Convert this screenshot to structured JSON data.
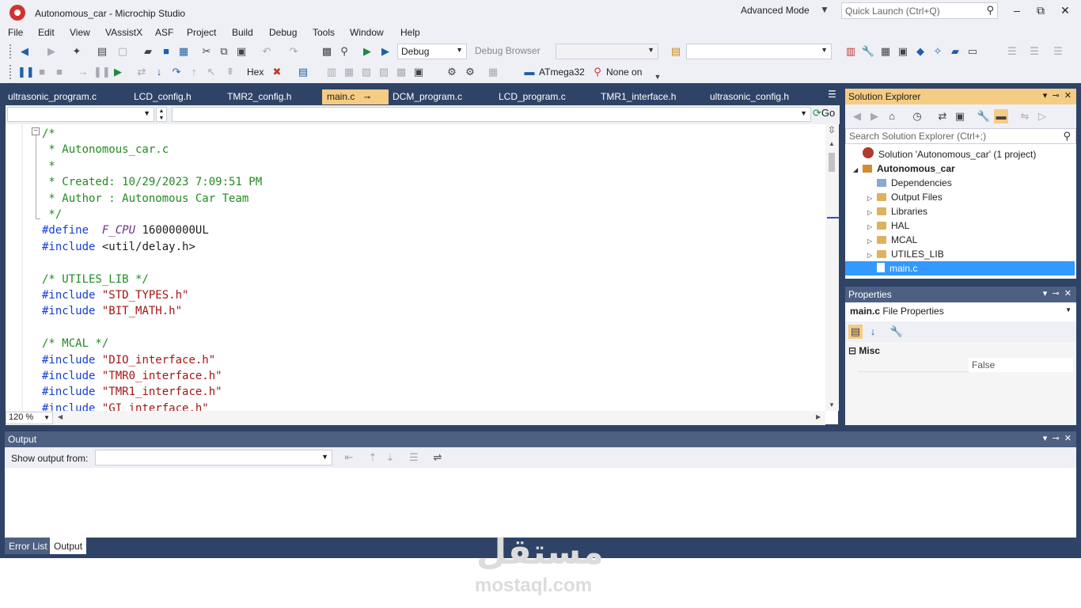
{
  "window": {
    "title": "Autonomous_car - Microchip Studio",
    "mode_label": "Advanced Mode",
    "quick_launch_placeholder": "Quick Launch (Ctrl+Q)",
    "minimize": "–",
    "maximize": "⧉",
    "close": "✕"
  },
  "menu": [
    "File",
    "Edit",
    "View",
    "VAssistX",
    "ASF",
    "Project",
    "Build",
    "Debug",
    "Tools",
    "Window",
    "Help"
  ],
  "toolbar": {
    "config_combo": "Debug",
    "debug_browser": "Debug Browser",
    "hex_label": "Hex",
    "device_label": "ATmega32",
    "tool_label": "None on"
  },
  "tabs": [
    {
      "label": "ultrasonic_program.c",
      "active": false
    },
    {
      "label": "LCD_config.h",
      "active": false
    },
    {
      "label": "TMR2_config.h",
      "active": false
    },
    {
      "label": "main.c",
      "active": true
    },
    {
      "label": "DCM_program.c",
      "active": false
    },
    {
      "label": "LCD_program.c",
      "active": false
    },
    {
      "label": "TMR1_interface.h",
      "active": false
    },
    {
      "label": "ultrasonic_config.h",
      "active": false
    }
  ],
  "editor": {
    "go_label": "Go",
    "zoom": "120 %",
    "lines": [
      [
        {
          "t": "cm",
          "v": "/*"
        }
      ],
      [
        {
          "t": "cm",
          "v": " * Autonomous_car.c"
        }
      ],
      [
        {
          "t": "cm",
          "v": " *"
        }
      ],
      [
        {
          "t": "cm",
          "v": " * Created: 10/29/2023 7:09:51 PM"
        }
      ],
      [
        {
          "t": "cm",
          "v": " * Author : Autonomous Car Team"
        }
      ],
      [
        {
          "t": "cm",
          "v": " */"
        }
      ],
      [
        {
          "t": "kw",
          "v": "#define"
        },
        {
          "t": "plain",
          "v": "  "
        },
        {
          "t": "mac",
          "v": "F_CPU"
        },
        {
          "t": "plain",
          "v": " 16000000UL"
        }
      ],
      [
        {
          "t": "kw",
          "v": "#include"
        },
        {
          "t": "plain",
          "v": " <util/delay.h>"
        }
      ],
      [
        {
          "t": "plain",
          "v": ""
        }
      ],
      [
        {
          "t": "cm",
          "v": "/* UTILES_LIB */"
        }
      ],
      [
        {
          "t": "kw",
          "v": "#include"
        },
        {
          "t": "plain",
          "v": " "
        },
        {
          "t": "str",
          "v": "\"STD_TYPES.h\""
        }
      ],
      [
        {
          "t": "kw",
          "v": "#include"
        },
        {
          "t": "plain",
          "v": " "
        },
        {
          "t": "str",
          "v": "\"BIT_MATH.h\""
        }
      ],
      [
        {
          "t": "plain",
          "v": ""
        }
      ],
      [
        {
          "t": "cm",
          "v": "/* MCAL */"
        }
      ],
      [
        {
          "t": "kw",
          "v": "#include"
        },
        {
          "t": "plain",
          "v": " "
        },
        {
          "t": "str",
          "v": "\"DIO_interface.h\""
        }
      ],
      [
        {
          "t": "kw",
          "v": "#include"
        },
        {
          "t": "plain",
          "v": " "
        },
        {
          "t": "str",
          "v": "\"TMR0_interface.h\""
        }
      ],
      [
        {
          "t": "kw",
          "v": "#include"
        },
        {
          "t": "plain",
          "v": " "
        },
        {
          "t": "str",
          "v": "\"TMR1_interface.h\""
        }
      ],
      [
        {
          "t": "kw",
          "v": "#include"
        },
        {
          "t": "plain",
          "v": " "
        },
        {
          "t": "str",
          "v": "\"GI_interface.h\""
        }
      ]
    ]
  },
  "solution_explorer": {
    "title": "Solution Explorer",
    "search_placeholder": "Search Solution Explorer (Ctrl+;)",
    "items": [
      {
        "label": "Solution 'Autonomous_car' (1 project)",
        "icon": "solution-icon",
        "expander": "",
        "level": 0,
        "bold": false,
        "selected": false
      },
      {
        "label": "Autonomous_car",
        "icon": "project-icon",
        "expander": "◢",
        "level": 0,
        "bold": true,
        "selected": false
      },
      {
        "label": "Dependencies",
        "icon": "dependencies-icon",
        "expander": "",
        "level": 1,
        "bold": false,
        "selected": false
      },
      {
        "label": "Output Files",
        "icon": "folder-icon",
        "expander": "▷",
        "level": 1,
        "bold": false,
        "selected": false
      },
      {
        "label": "Libraries",
        "icon": "folder-icon",
        "expander": "▷",
        "level": 1,
        "bold": false,
        "selected": false
      },
      {
        "label": "HAL",
        "icon": "folder-icon",
        "expander": "▷",
        "level": 1,
        "bold": false,
        "selected": false
      },
      {
        "label": "MCAL",
        "icon": "folder-icon",
        "expander": "▷",
        "level": 1,
        "bold": false,
        "selected": false
      },
      {
        "label": "UTILES_LIB",
        "icon": "folder-icon",
        "expander": "▷",
        "level": 1,
        "bold": false,
        "selected": false
      },
      {
        "label": "main.c",
        "icon": "c-file-icon",
        "expander": "",
        "level": 1,
        "bold": false,
        "selected": true
      }
    ]
  },
  "properties": {
    "title": "Properties",
    "object_name": "main.c",
    "object_type": "File Properties",
    "category": "Misc",
    "value": "False"
  },
  "output": {
    "title": "Output",
    "show_from_label": "Show output from:"
  },
  "bottom_tabs": {
    "error_list": "Error List",
    "output": "Output"
  },
  "watermark": {
    "logo": "مستقل",
    "text": "mostaql.com"
  },
  "colors": {
    "frame": "#2f4366",
    "accent_tab": "#f5cc84",
    "keyword": "#1440d0",
    "comment": "#228b22",
    "string": "#a31515",
    "selection": "#3399ff"
  }
}
